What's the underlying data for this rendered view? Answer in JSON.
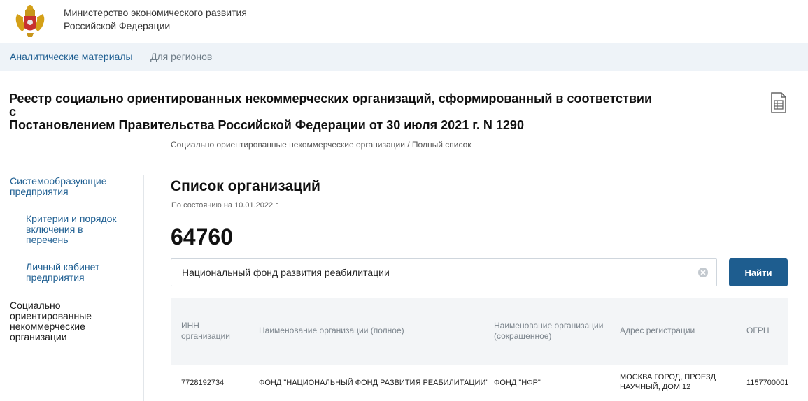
{
  "header": {
    "ministry_line1": "Министерство экономического развития",
    "ministry_line2": "Российской Федерации"
  },
  "nav": {
    "items": [
      {
        "label": "Аналитические материалы"
      },
      {
        "label": "Для регионов"
      }
    ]
  },
  "registry": {
    "title_line1": "Реестр социально ориентированных некоммерческих организаций, сформированный в соответствии с",
    "title_line2": "Постановлением Правительства Российской Федерации от 30 июля 2021 г. N 1290",
    "icon": "document-table-icon"
  },
  "breadcrumb": {
    "text": "Социально ориентированные некоммерческие организации  / Полный список"
  },
  "sidebar": {
    "items": [
      {
        "line1": "Системообразующие",
        "line2": "предприятия"
      },
      {
        "line1": "Критерии и порядок",
        "line2": "включения в",
        "line3": "перечень"
      },
      {
        "line1": "Личный кабинет",
        "line2": "предприятия"
      },
      {
        "line1": "Социально",
        "line2": "ориентированные",
        "line3": "некоммерческие",
        "line4": "организации"
      }
    ]
  },
  "main": {
    "title": "Список организаций",
    "as_of": "По состоянию на 10.01.2022 г.",
    "count": "64760"
  },
  "search": {
    "value": "Национальный фонд развития реабилитации",
    "button_label": "Найти",
    "clear_icon": "clear-circle-icon"
  },
  "table": {
    "headers": [
      {
        "line1": "ИНН",
        "line2": "организации"
      },
      {
        "line1": "Наименование организации (полное)"
      },
      {
        "line1": "Наименование организации",
        "line2": "(сокращенное)"
      },
      {
        "line1": "Адрес регистрации"
      },
      {
        "line1": "ОГРН"
      }
    ],
    "rows": [
      {
        "inn": "7728192734",
        "full_name": "ФОНД \"НАЦИОНАЛЬНЫЙ ФОНД РАЗВИТИЯ РЕАБИЛИТАЦИИ\"",
        "short_name": "ФОНД \"НФР\"",
        "address_line1": "МОСКВА ГОРОД, ПРОЕЗД",
        "address_line2": "НАУЧНЫЙ, ДОМ 12",
        "ogrn": "1157700001"
      }
    ]
  },
  "colors": {
    "accent": "#1e5d8f",
    "nav_bg": "#eef3f8",
    "table_header_bg": "#f3f5f7"
  }
}
